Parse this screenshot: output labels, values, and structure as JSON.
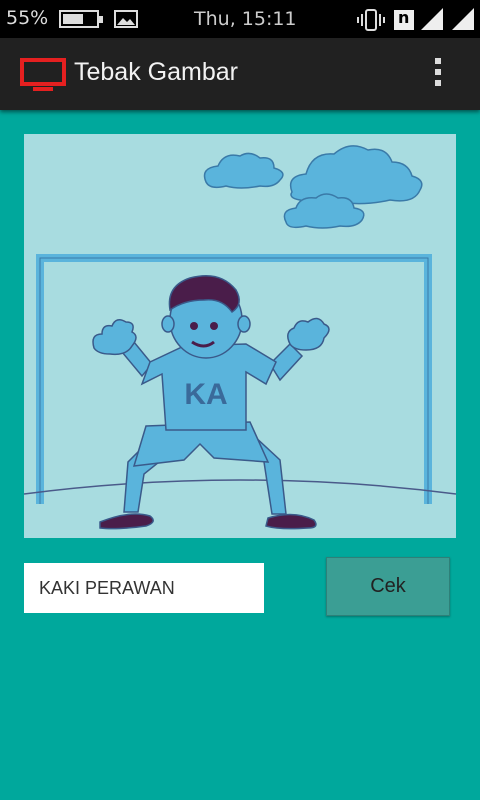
{
  "status_bar": {
    "battery_percent_text": "55%",
    "battery_level": 0.55,
    "clock": "Thu, 15:11",
    "icons": [
      "battery-icon",
      "image-notification-icon",
      "vibrate-icon",
      "nfc-icon",
      "signal-icon",
      "signal-icon"
    ]
  },
  "app_bar": {
    "title": "Tebak Gambar",
    "icon": "tv-monitor-icon",
    "menu_icon": "overflow-menu-icon"
  },
  "puzzle": {
    "shirt_text": "KA",
    "description_icons": [
      "cloud-icon",
      "goal-icon",
      "goalkeeper-icon"
    ]
  },
  "answer": {
    "value": "KAKI PERAWAN",
    "placeholder": ""
  },
  "check_button": {
    "label": "Cek"
  },
  "colors": {
    "background": "#00a89c",
    "app_bar": "#212121",
    "picture_bg": "#a8dce0",
    "figure_blue": "#5ab4dc",
    "dark_purple": "#4a1d4a",
    "button": "#3b9e94",
    "app_icon_red": "#e52020"
  }
}
